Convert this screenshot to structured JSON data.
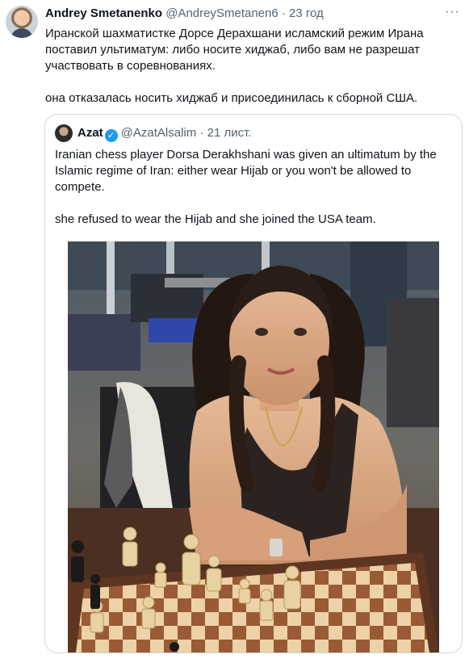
{
  "tweet": {
    "author_name": "Andrey Smetanenko",
    "author_handle": "@AndreySmetanen6",
    "separator": "·",
    "time": "23 год",
    "more_icon": "more-horizontal-icon",
    "text_paragraphs": [
      "Иранской шахматистке Дорсе Дерахшани исламский режим Ирана поставил ультиматум: либо носите хиджаб, либо вам не разрешат участвовать в соревнованиях.",
      "она отказалась носить хиджаб и присоединилась к сборной США."
    ]
  },
  "quoted_tweet": {
    "author_name": "Azat",
    "verified_icon": "verified-badge-icon",
    "author_handle": "@AzatAlsalim",
    "separator": "·",
    "time": "21 лист.",
    "text_paragraphs": [
      "Iranian chess player Dorsa Derakhshani was given an ultimatum by the Islamic regime of Iran: either wear Hijab or you won't be allowed to compete.",
      "she refused to wear the Hijab and she joined the USA team."
    ]
  },
  "colors": {
    "text": "#0f1419",
    "secondary": "#536471",
    "border": "#cfd9de",
    "verified": "#1d9bf0"
  }
}
